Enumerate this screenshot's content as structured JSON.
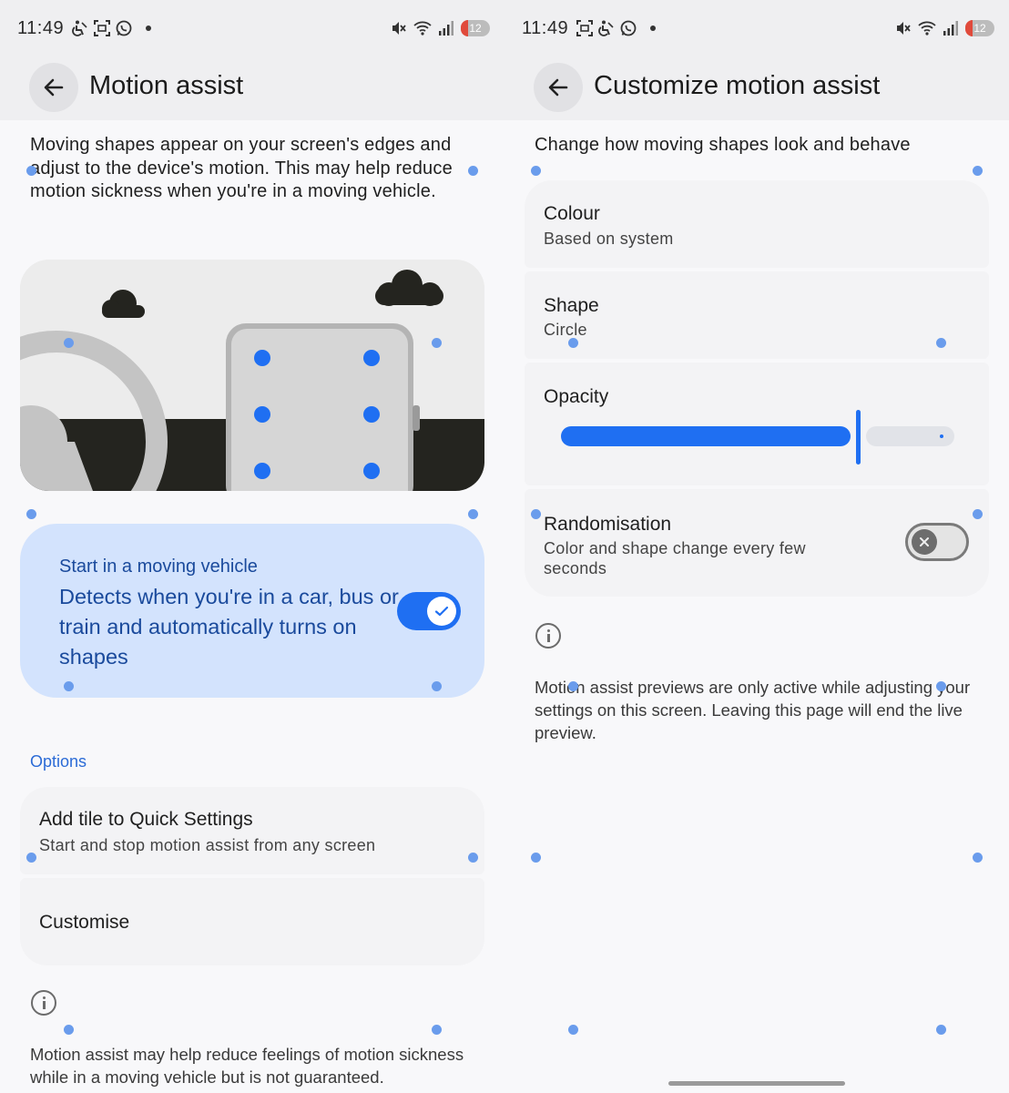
{
  "status_bar": {
    "time": "11:49",
    "battery": "12"
  },
  "left": {
    "title": "Motion assist",
    "description": "Moving shapes appear on your screen's edges and adjust to the device's motion. This may help reduce motion sickness when you're in a moving vehicle.",
    "primary_card": {
      "title": "Start in a moving vehicle",
      "description": "Detects when you're in a car, bus or train and automatically turns on shapes",
      "toggle_on": true
    },
    "section_label": "Options",
    "items": [
      {
        "title": "Add tile to Quick Settings",
        "subtitle": "Start and stop motion assist from any screen"
      },
      {
        "title": "Customise"
      }
    ],
    "footnote": "Motion assist may help reduce feelings of motion sickness while in a moving vehicle but is not guaranteed."
  },
  "right": {
    "title": "Customize motion assist",
    "description": "Change how moving shapes look and behave",
    "colour": {
      "title": "Colour",
      "value": "Based on system"
    },
    "shape": {
      "title": "Shape",
      "value": "Circle"
    },
    "opacity": {
      "title": "Opacity",
      "value": 0.75
    },
    "randomisation": {
      "title": "Randomisation",
      "subtitle": "Color and shape change every few seconds",
      "toggle_on": false
    },
    "info_text": "Motion assist previews are only active while adjusting your settings on this screen. Leaving this page will end the live preview."
  },
  "colors": {
    "accent": "#1f6ff2",
    "card_blue": "#d3e3fd",
    "preview_dot": "#6a9cec"
  }
}
